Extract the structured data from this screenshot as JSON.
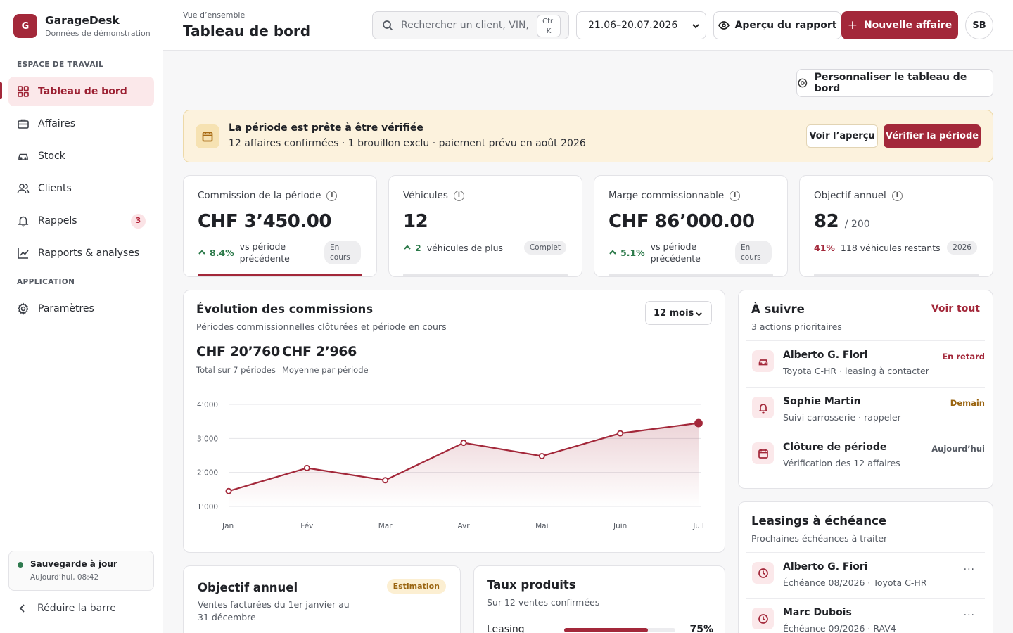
{
  "brand": {
    "initial": "G",
    "name": "GarageDesk",
    "subtitle": "Données de démonstration"
  },
  "sidebar": {
    "section_workspace": "ESPACE DE TRAVAIL",
    "section_app": "APPLICATION",
    "items": [
      {
        "label": "Tableau de bord",
        "icon": "grid-icon"
      },
      {
        "label": "Affaires",
        "icon": "briefcase-icon"
      },
      {
        "label": "Stock",
        "icon": "car-icon"
      },
      {
        "label": "Clients",
        "icon": "users-icon"
      },
      {
        "label": "Rappels",
        "icon": "bell-icon",
        "badge": "3"
      },
      {
        "label": "Rapports & analyses",
        "icon": "chart-icon"
      },
      {
        "label": "Paramètres",
        "icon": "gear-icon"
      }
    ],
    "save_status": {
      "title": "Sauvegarde à jour",
      "time": "Aujourd’hui, 08:42"
    },
    "collapse_label": "Réduire la barre"
  },
  "header": {
    "breadcrumb": "Vue d’ensemble",
    "title": "Tableau de bord",
    "search_placeholder": "Rechercher un client, VIN, ...",
    "shortcut_line1": "Ctrl",
    "shortcut_line2": "K",
    "date_range": "21.06–20.07.2026",
    "preview_label": "Aperçu du rapport",
    "new_label": "Nouvelle affaire",
    "avatar": "SB"
  },
  "customize_label": "Personnaliser le tableau de bord",
  "alert": {
    "title": "La période est prête à être vérifiée",
    "text": "12 affaires confirmées · 1 brouillon exclu · paiement prévu en août 2026",
    "preview_btn": "Voir l’aperçu",
    "verify_btn": "Vérifier la période"
  },
  "kpis": [
    {
      "label": "Commission de la période",
      "value": "CHF 3’450.00",
      "trend": "8.4%",
      "trend_text": "vs période précédente",
      "pill": "En cours",
      "progress": 1.0
    },
    {
      "label": "Véhicules",
      "value": "12",
      "trend": "2",
      "trend_text": "véhicules de plus",
      "pill": "Complet",
      "progress": 0
    },
    {
      "label": "Marge commissionnable",
      "value": "CHF 86’000.00",
      "trend": "5.1%",
      "trend_text": "vs période précédente",
      "pill": "En cours",
      "progress": 0
    },
    {
      "label": "Objectif annuel",
      "value": "82",
      "value_sub": "/ 200",
      "trend": "41%",
      "trend_text": "118 véhicules restants",
      "pill": "2026",
      "progress": 0
    }
  ],
  "commissions": {
    "title": "Évolution des commissions",
    "subtitle": "Périodes commissionnelles clôturées et période en cours",
    "range_select": "12 mois",
    "total_value": "CHF 20’760",
    "total_label": "Total sur 7 périodes",
    "avg_value": "CHF 2’966",
    "avg_label": "Moyenne par période"
  },
  "chart_data": {
    "type": "area",
    "categories": [
      "Jan",
      "Fév",
      "Mar",
      "Avr",
      "Mai",
      "Juin",
      "Juil"
    ],
    "y_tick_labels": [
      "4’000",
      "3’000",
      "2’000",
      "1’000"
    ],
    "y_ticks": [
      4000,
      3000,
      2000,
      1000
    ],
    "ylim": [
      1000,
      4000
    ],
    "series": [
      {
        "values": [
          1450,
          2130,
          1770,
          2870,
          2480,
          3150,
          3450
        ]
      }
    ],
    "grid": true,
    "color": "#a3283a"
  },
  "todo": {
    "title": "À suivre",
    "subtitle": "3 actions prioritaires",
    "link": "Voir tout",
    "items": [
      {
        "name": "Alberto G. Fiori",
        "sub": "Toyota C-HR · leasing à contacter",
        "tag": "En retard",
        "tag_color": "#a3283a",
        "icon": "car-icon"
      },
      {
        "name": "Sophie Martin",
        "sub": "Suivi carrosserie · rappeler",
        "tag": "Demain",
        "tag_color": "#9a6410",
        "icon": "bell-icon"
      },
      {
        "name": "Clôture de période",
        "sub": "Vérification des 12 affaires",
        "tag": "Aujourd’hui",
        "tag_color": "#555a63",
        "icon": "calendar-icon"
      }
    ]
  },
  "leasing": {
    "title": "Leasings à échéance",
    "subtitle": "Prochaines échéances à traiter",
    "items": [
      {
        "name": "Alberto G. Fiori",
        "sub": "Échéance 08/2026 · Toyota C-HR",
        "more": "···",
        "icon": "clock-icon"
      },
      {
        "name": "Marc Dubois",
        "sub": "Échéance 09/2026 · RAV4",
        "more": "···",
        "icon": "clock-icon"
      }
    ]
  },
  "annual": {
    "title": "Objectif annuel",
    "subtitle": "Ventes facturées du 1er janvier au 31 décembre",
    "badge": "Estimation"
  },
  "rates": {
    "title": "Taux produits",
    "subtitle": "Sur 12 ventes confirmées",
    "items": [
      {
        "label": "Leasing",
        "value": "75%",
        "fraction": 0.75
      }
    ]
  }
}
